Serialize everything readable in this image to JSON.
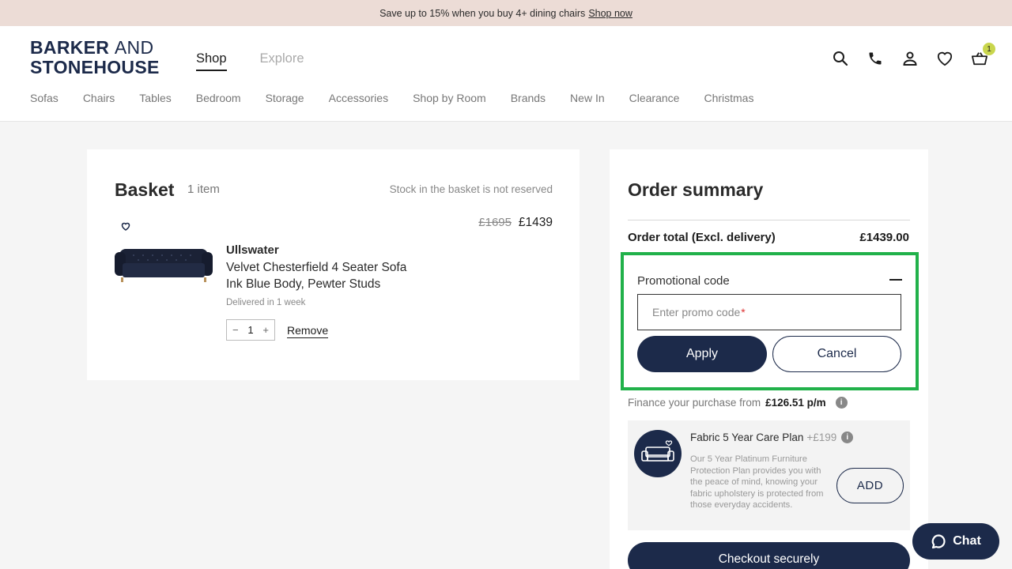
{
  "promo_bar": {
    "text": "Save up to 15% when you buy 4+ dining chairs",
    "link": "Shop now"
  },
  "logo": {
    "line1_bold": "BARKER",
    "line1_thin": "AND",
    "line2": "STONEHOUSE"
  },
  "main_nav": [
    {
      "label": "Shop",
      "active": true
    },
    {
      "label": "Explore",
      "active": false
    }
  ],
  "header_icons": [
    "search-icon",
    "phone-icon",
    "account-icon",
    "wishlist-icon",
    "basket-icon"
  ],
  "basket_count": "1",
  "categories": [
    "Sofas",
    "Chairs",
    "Tables",
    "Bedroom",
    "Storage",
    "Accessories",
    "Shop by Room",
    "Brands",
    "New In",
    "Clearance",
    "Christmas"
  ],
  "basket": {
    "title": "Basket",
    "count": "1 item",
    "stock_note": "Stock in the basket is not reserved",
    "item": {
      "old_price": "£1695",
      "price": "£1439",
      "brand": "Ullswater",
      "name": "Velvet Chesterfield 4 Seater Sofa",
      "variant": "Ink Blue Body, Pewter Studs",
      "delivery": "Delivered in 1 week",
      "quantity": "1",
      "minus": "−",
      "plus": "+",
      "remove": "Remove"
    }
  },
  "summary": {
    "title": "Order summary",
    "total_label": "Order total (Excl. delivery)",
    "total_value": "£1439.00",
    "promo": {
      "label": "Promotional code",
      "placeholder": "Enter promo code",
      "required_mark": "*",
      "apply": "Apply",
      "cancel": "Cancel"
    },
    "finance_text": "Finance your purchase from",
    "finance_amount": "£126.51 p/m",
    "care": {
      "title": "Fabric 5 Year Care Plan",
      "price": "+£199",
      "description": "Our 5 Year Platinum Furniture Protection Plan provides you with the peace of mind, knowing your fabric upholstery is protected from those everyday accidents.",
      "add": "ADD"
    },
    "checkout": "Checkout securely"
  },
  "chat": {
    "label": "Chat"
  },
  "colors": {
    "navy": "#1c2a4a",
    "promo_bar": "#ecdcd6",
    "highlight": "#21b14a",
    "badge": "#c9d64d"
  }
}
